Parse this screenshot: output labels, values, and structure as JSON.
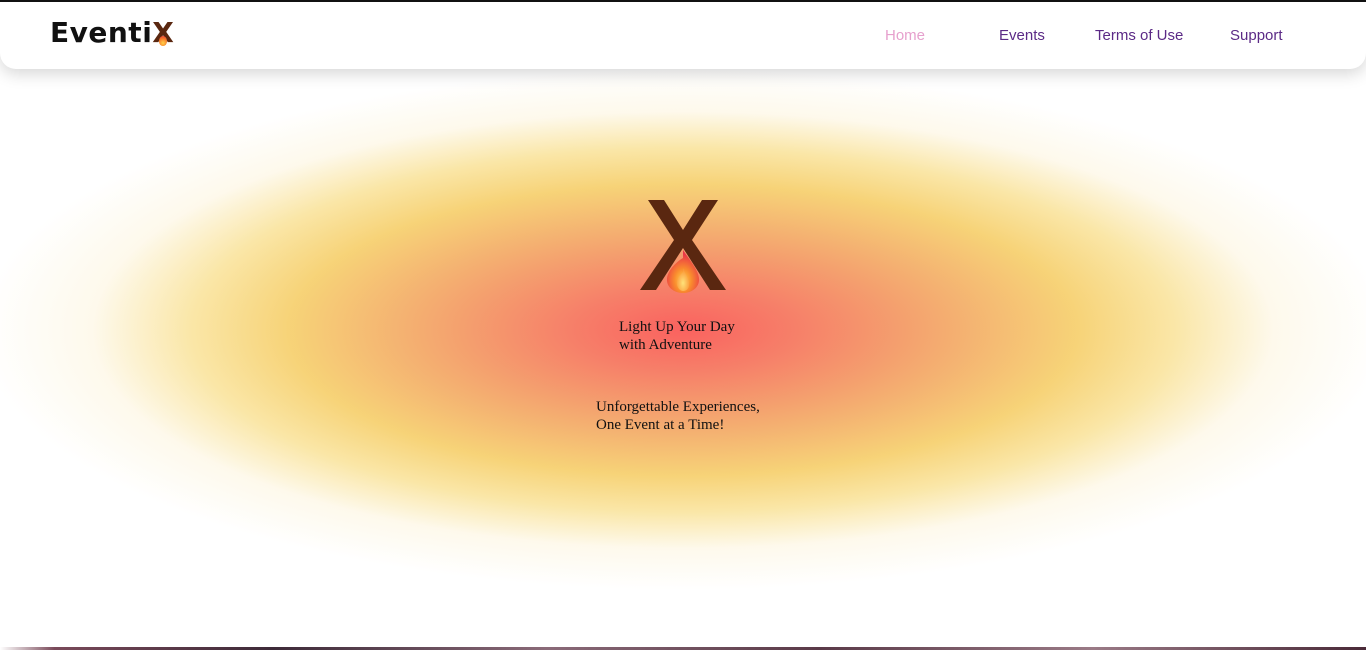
{
  "brand": {
    "name_prefix": "Eventi",
    "name_suffix": "X",
    "accent_color": "#5a2710"
  },
  "nav": {
    "items": [
      {
        "label": "Home",
        "active": true
      },
      {
        "label": "Events",
        "active": false
      },
      {
        "label": "Terms of Use",
        "active": false
      },
      {
        "label": "Support",
        "active": false
      }
    ],
    "active_color": "#e6a0cd",
    "link_color": "#5b2a86"
  },
  "hero": {
    "logo_icon": "flame-x-icon",
    "tagline": "Light  Up Your Day\nwith Adventure",
    "subline": "Unforgettable Experiences,\nOne Event at a Time!",
    "glow_colors": [
      "#fa625f",
      "#f3a568",
      "#f6cf6c"
    ]
  }
}
